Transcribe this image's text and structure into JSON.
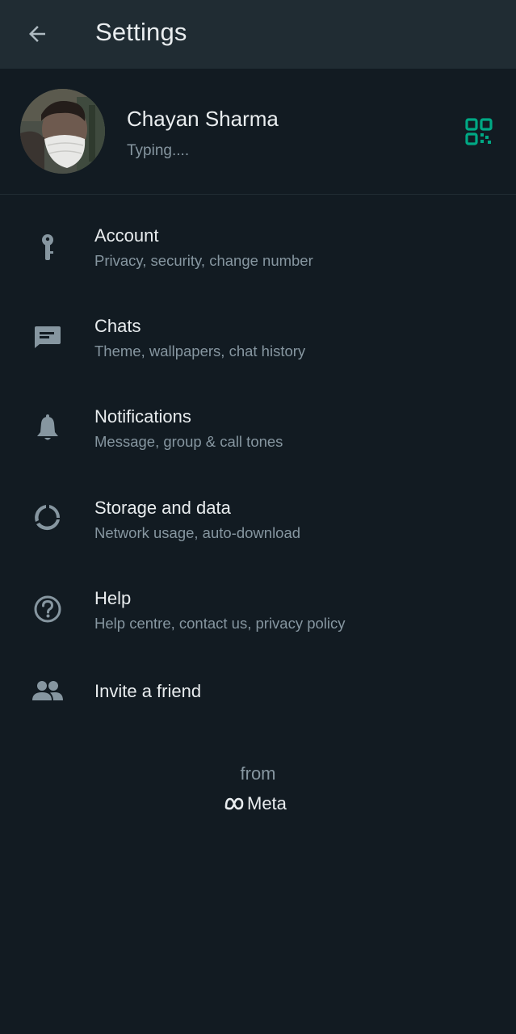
{
  "header": {
    "title": "Settings",
    "back_icon": "arrow-left-icon"
  },
  "profile": {
    "name": "Chayan Sharma",
    "status": "Typing....",
    "qr_icon": "qr-code-icon",
    "accent_color": "#00a884"
  },
  "items": [
    {
      "title": "Account",
      "subtitle": "Privacy, security, change number",
      "icon": "key-icon"
    },
    {
      "title": "Chats",
      "subtitle": "Theme, wallpapers, chat history",
      "icon": "chat-icon"
    },
    {
      "title": "Notifications",
      "subtitle": "Message, group & call tones",
      "icon": "bell-icon"
    },
    {
      "title": "Storage and data",
      "subtitle": "Network usage, auto-download",
      "icon": "data-usage-icon"
    },
    {
      "title": "Help",
      "subtitle": "Help centre, contact us, privacy policy",
      "icon": "help-icon"
    },
    {
      "title": "Invite a friend",
      "subtitle": "",
      "icon": "people-icon"
    }
  ],
  "footer": {
    "from": "from",
    "brand": "Meta"
  },
  "colors": {
    "background": "#121b22",
    "header": "#202c33",
    "primary_text": "#e9edef",
    "secondary_text": "#8696a0",
    "icon": "#8696a0"
  }
}
